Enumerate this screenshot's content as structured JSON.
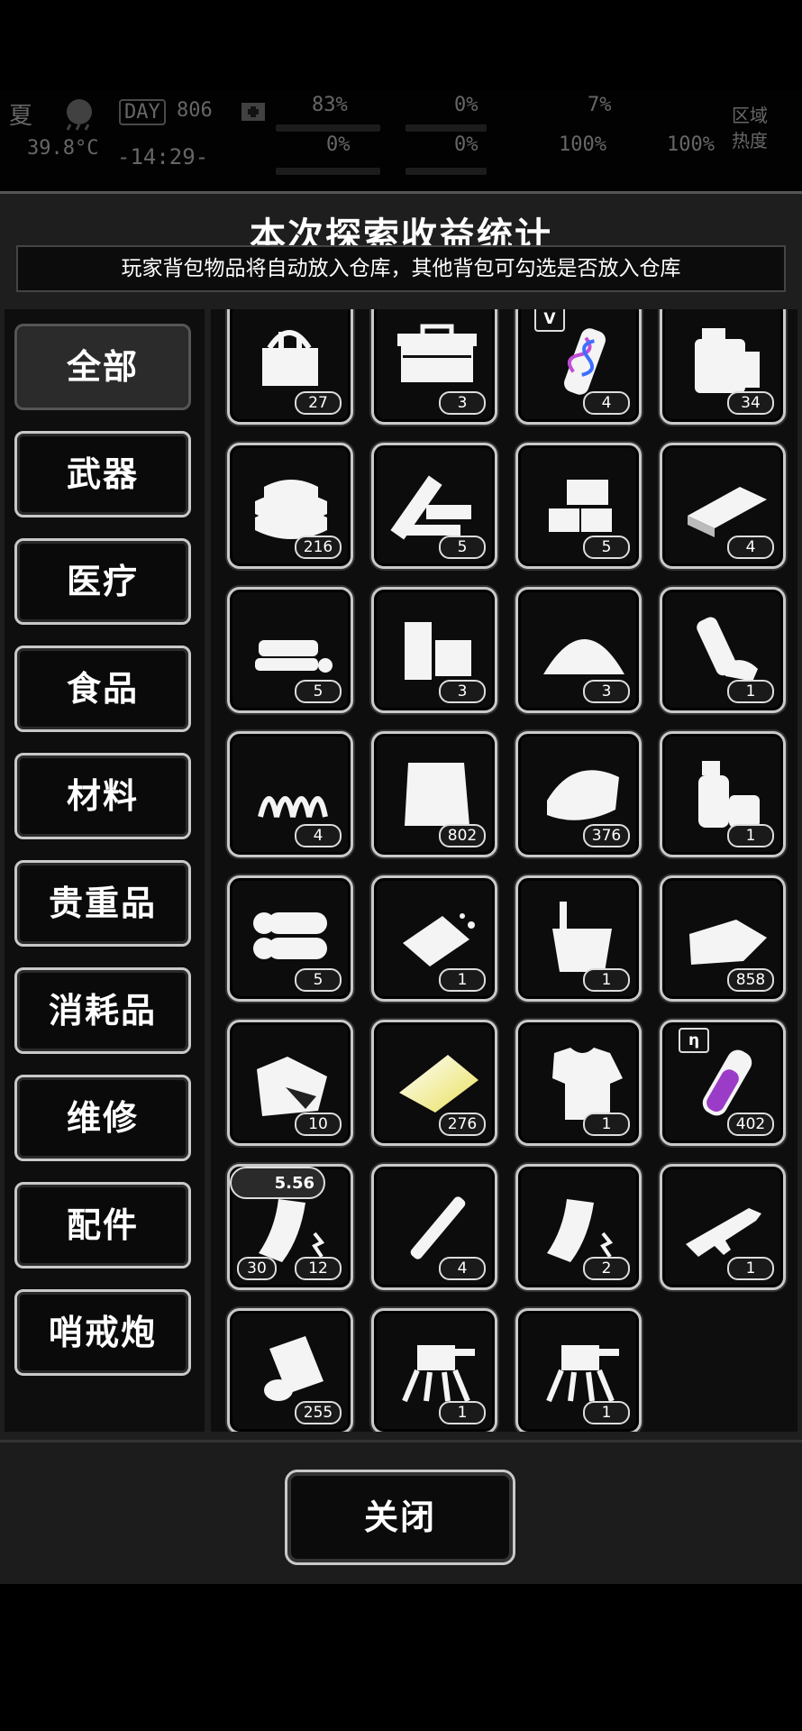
{
  "hud": {
    "season": "夏",
    "temperature": "39.8°C",
    "day_label": "DAY",
    "day_number": "806",
    "clock": "-14:29-",
    "stats": [
      "83%",
      "0%",
      "0%",
      "0%",
      "7%",
      "0%",
      "100%",
      "100%"
    ],
    "area_label_1": "区域",
    "area_label_2": "热度"
  },
  "panel": {
    "title": "本次探索收益统计",
    "notice": "玩家背包物品将自动放入仓库，其他背包可勾选是否放入仓库"
  },
  "categories": [
    {
      "label": "全部",
      "active": true
    },
    {
      "label": "武器"
    },
    {
      "label": "医疗"
    },
    {
      "label": "食品"
    },
    {
      "label": "材料"
    },
    {
      "label": "贵重品"
    },
    {
      "label": "消耗品"
    },
    {
      "label": "维修"
    },
    {
      "label": "配件"
    },
    {
      "label": "哨戒炮"
    }
  ],
  "items": [
    {
      "icon": "tool-bag-icon",
      "count": "27"
    },
    {
      "icon": "toolbox-icon",
      "count": "3"
    },
    {
      "icon": "dna-vial-icon",
      "count": "4",
      "badge": "V"
    },
    {
      "icon": "fuel-canister-icon",
      "count": "34"
    },
    {
      "icon": "cloth-stack-icon",
      "count": "216"
    },
    {
      "icon": "wood-planks-icon",
      "count": "5"
    },
    {
      "icon": "bricks-icon",
      "count": "5"
    },
    {
      "icon": "metal-plate-icon",
      "count": "4"
    },
    {
      "icon": "stone-slabs-icon",
      "count": "5"
    },
    {
      "icon": "wood-blocks-icon",
      "count": "3"
    },
    {
      "icon": "sand-pile-icon",
      "count": "3"
    },
    {
      "icon": "plastic-bottle-icon",
      "count": "1"
    },
    {
      "icon": "spring-icon",
      "count": "4"
    },
    {
      "icon": "paper-sheet-icon",
      "count": "802"
    },
    {
      "icon": "folded-cloth-icon",
      "count": "376"
    },
    {
      "icon": "spray-bottle-icon",
      "count": "1"
    },
    {
      "icon": "logs-icon",
      "count": "5"
    },
    {
      "icon": "soap-bar-icon",
      "count": "1"
    },
    {
      "icon": "glue-bucket-icon",
      "count": "1"
    },
    {
      "icon": "rags-icon",
      "count": "858"
    },
    {
      "icon": "ore-chunk-icon",
      "count": "10"
    },
    {
      "icon": "gold-fabric-icon",
      "count": "276"
    },
    {
      "icon": "torn-shirt-icon",
      "count": "1"
    },
    {
      "icon": "purple-tube-icon",
      "count": "402",
      "badge": "η"
    },
    {
      "icon": "rifle-magazine-icon",
      "count": "12",
      "count2": "30",
      "caliber": "5.56"
    },
    {
      "icon": "barrel-tube-icon",
      "count": "4"
    },
    {
      "icon": "rifle-magazine-icon",
      "count": "2"
    },
    {
      "icon": "assault-rifle-icon",
      "count": "1"
    },
    {
      "icon": "tape-roll-icon",
      "count": "255"
    },
    {
      "icon": "sentry-turret-icon",
      "count": "1"
    },
    {
      "icon": "sentry-turret-icon",
      "count": "1"
    }
  ],
  "footer": {
    "close_label": "关闭"
  }
}
